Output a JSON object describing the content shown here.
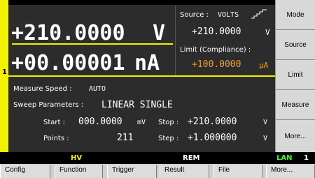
{
  "channel": "1",
  "primary": {
    "voltage_value": "+210.0000",
    "voltage_unit": "V",
    "current_value": "+00.00001",
    "current_unit": "nA"
  },
  "source": {
    "label": "Source :",
    "mode": "VOLTS",
    "value": "+210.0000",
    "unit": "V"
  },
  "limit": {
    "label": "Limit (Compliance) :",
    "value": "+100.0000",
    "unit": "µA"
  },
  "measure_speed": {
    "label": "Measure Speed :",
    "value": "AUTO"
  },
  "sweep_parameters": {
    "label": "Sweep Parameters :",
    "value": "LINEAR SINGLE"
  },
  "sweep": {
    "start_label": "Start :",
    "start_value": "000.0000",
    "start_unit": "mV",
    "stop1_label": "Stop :",
    "stop1_value": "+210.0000",
    "stop1_unit": "V",
    "points_label": "Points :",
    "points_value": "211",
    "step_label": "Step :",
    "step_value": "+1.000000",
    "step_unit": "V"
  },
  "softkeys": [
    "Mode",
    "Source",
    "Limit",
    "Measure",
    "More..."
  ],
  "status_bar": {
    "hv": "HV",
    "rem": "REM",
    "lan": "LAN",
    "lan_num": "1"
  },
  "function_keys": [
    "Config",
    "Function",
    "Trigger",
    "Result",
    "File",
    "More..."
  ],
  "colors": {
    "accent": "#f2f200",
    "panel": "#2c2c2c",
    "limit_text": "#f0a030",
    "lan_text": "#33ff33"
  }
}
